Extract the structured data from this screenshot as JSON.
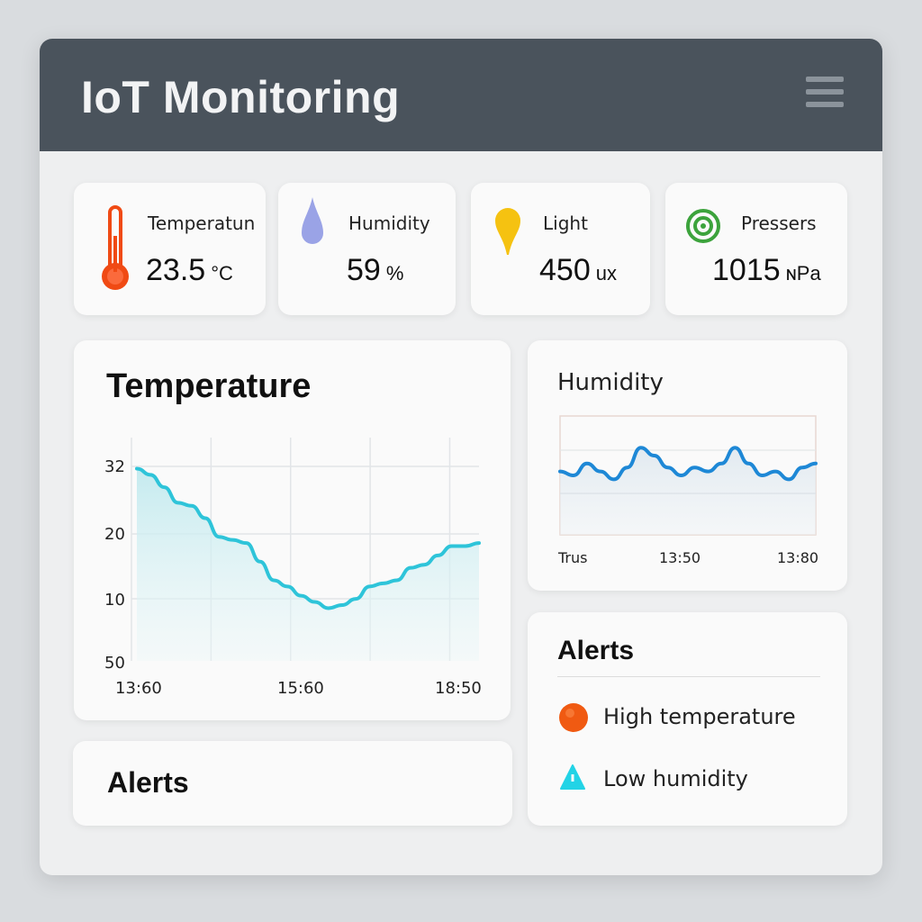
{
  "header": {
    "title": "IoT Monitoring"
  },
  "metrics": [
    {
      "label": "Temperatun",
      "value": "23.5",
      "unit": "°C",
      "icon": "thermometer-icon"
    },
    {
      "label": "Humidity",
      "value": "59",
      "unit": "%",
      "icon": "droplet-icon"
    },
    {
      "label": "Light",
      "value": "450",
      "unit": "ux",
      "icon": "light-bulb-icon"
    },
    {
      "label": "Pressers",
      "value": "1015",
      "unit": "ɴPa",
      "icon": "gauge-icon"
    }
  ],
  "temperature_chart": {
    "title": "Temperature",
    "y_ticks": [
      "32",
      "20",
      "10",
      "50"
    ],
    "x_ticks": [
      "13:60",
      "15:60",
      "18:50"
    ]
  },
  "humidity_chart": {
    "title": "Humidity",
    "x_ticks": [
      "Trus",
      "13:50",
      "13:80"
    ]
  },
  "alerts_left": {
    "title": "Alerts"
  },
  "alerts_right": {
    "title": "Alerts",
    "items": [
      {
        "text": "High temperature",
        "icon": "alert-circle-icon",
        "color": "#f05a12"
      },
      {
        "text": "Low humidity",
        "icon": "alert-triangle-icon",
        "color": "#22d3e6"
      }
    ]
  },
  "colors": {
    "header_bg": "#4a535c",
    "temp_line": "#2ec4d9",
    "humidity_line": "#1e88d6",
    "thermometer": "#f04a14",
    "gauge": "#3ca33c",
    "droplet": "#9aa3e6",
    "bulb": "#f5c211"
  },
  "chart_data": [
    {
      "type": "line",
      "title": "Temperature",
      "x_tick_labels": [
        "13:60",
        "15:60",
        "18:50"
      ],
      "y_tick_labels": [
        "32",
        "20",
        "10",
        "50"
      ],
      "series": [
        {
          "values": [
            31,
            30,
            28,
            25.5,
            25,
            23,
            20,
            19.5,
            19,
            16,
            13,
            12,
            10.5,
            9.5,
            8.5,
            9,
            10,
            12,
            12.5,
            13,
            15,
            15.5,
            17,
            18.5,
            18.5,
            19
          ]
        }
      ]
    },
    {
      "type": "line",
      "title": "Humidity",
      "x_tick_labels": [
        "Trus",
        "13:50",
        "13:80"
      ],
      "series": [
        {
          "values": [
            56,
            55,
            58,
            56,
            54,
            57,
            62,
            60,
            57,
            55,
            57,
            56,
            58,
            62,
            58,
            55,
            56,
            54,
            57,
            58
          ]
        }
      ]
    }
  ]
}
